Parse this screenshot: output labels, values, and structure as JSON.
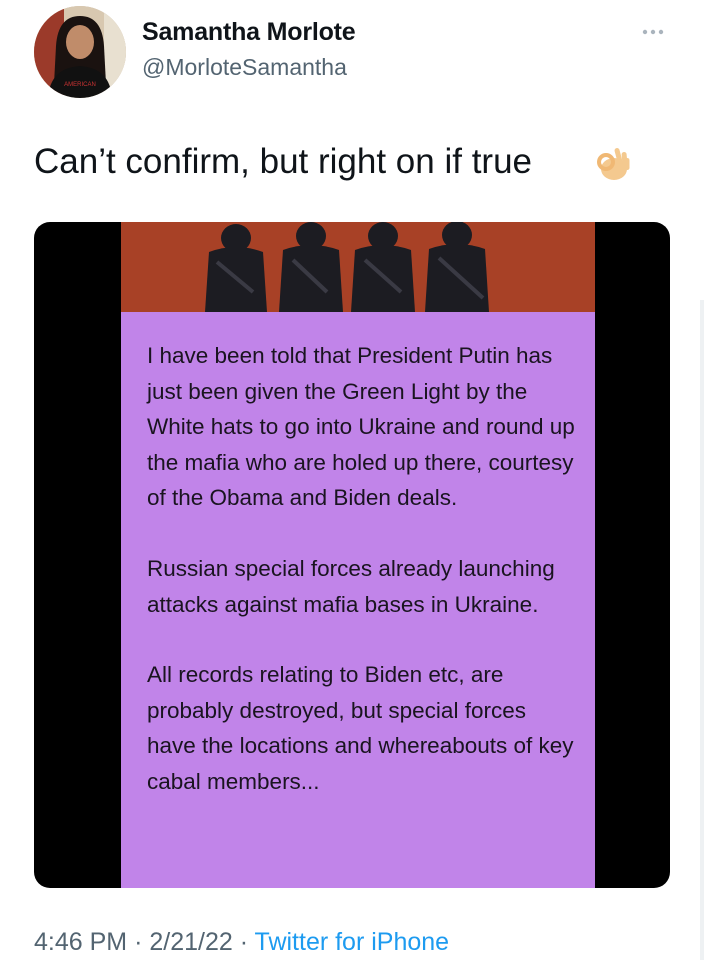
{
  "author": {
    "display_name": "Samantha Morlote",
    "handle": "@MorloteSamantha",
    "avatar_shirt_text": "AMERICAN MADE"
  },
  "tweet": {
    "text": "Can’t confirm, but right on if true",
    "emoji": "ok-hand-emoji"
  },
  "media": {
    "paragraphs": [
      "I have been told that President Putin has just been given the Green Light by the White hats to go into Ukraine and round up the mafia who are holed up there, courtesy of the Obama and Biden deals.",
      "Russian special forces already launching attacks against mafia bases in Ukraine.",
      "All records relating to Biden etc, are probably destroyed, but special forces have the locations and whereabouts of key cabal members..."
    ],
    "background_color": "#c184e9",
    "photo_background_color": "#b5492a"
  },
  "meta": {
    "time": "4:46 PM",
    "separator": "·",
    "date": "2/21/22",
    "source": "Twitter for iPhone"
  },
  "icons": {
    "more": "more-horizontal-icon"
  }
}
